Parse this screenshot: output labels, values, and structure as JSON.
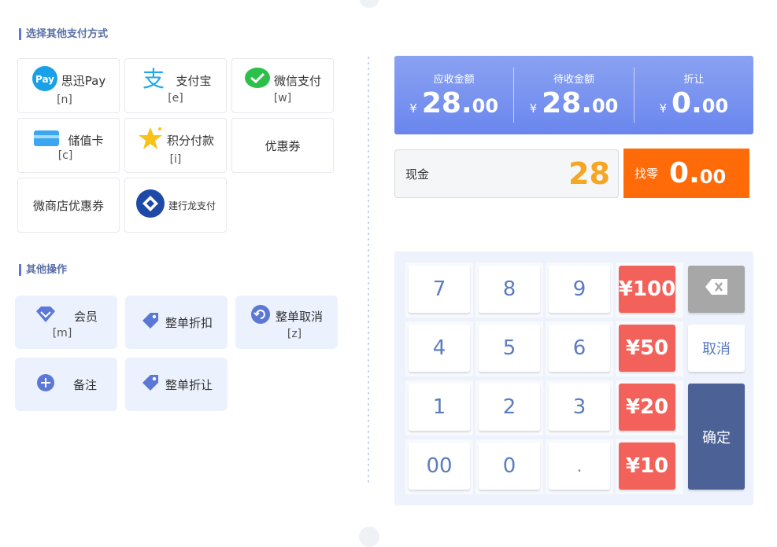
{
  "sections": {
    "payment_title": "选择其他支付方式",
    "ops_title": "其他操作"
  },
  "payments": [
    {
      "label": "思迅Pay",
      "key": "[n]",
      "icon": "pay-icon"
    },
    {
      "label": "支付宝",
      "key": "[e]",
      "icon": "alipay-icon"
    },
    {
      "label": "微信支付",
      "key": "[w]",
      "icon": "wechat-icon"
    },
    {
      "label": "储值卡",
      "key": "[c]",
      "icon": "card-icon"
    },
    {
      "label": "积分付款",
      "key": "[i]",
      "icon": "star-icon"
    },
    {
      "label": "优惠券",
      "key": "",
      "icon": ""
    },
    {
      "label": "微商店优惠券",
      "key": "",
      "icon": ""
    },
    {
      "label": "建行龙支付",
      "key": "",
      "icon": "ccb-icon"
    }
  ],
  "operations": [
    {
      "label": "会员",
      "key": "[m]",
      "icon": "diamond-icon"
    },
    {
      "label": "整单折扣",
      "key": "",
      "icon": "tag-icon"
    },
    {
      "label": "整单取消",
      "key": "[z]",
      "icon": "undo-icon"
    },
    {
      "label": "备注",
      "key": "",
      "icon": "plus-circle-icon"
    },
    {
      "label": "整单折让",
      "key": "",
      "icon": "tag-icon"
    }
  ],
  "summary": {
    "currency": "¥",
    "receivable": {
      "title": "应收金额",
      "int": "28.",
      "dec": "00"
    },
    "pending": {
      "title": "待收金额",
      "int": "28.",
      "dec": "00"
    },
    "discount": {
      "title": "折让",
      "int": "0.",
      "dec": "00"
    }
  },
  "cash": {
    "label": "现金",
    "amount": "28"
  },
  "change": {
    "label": "找零",
    "int": "0.",
    "dec": "00"
  },
  "keypad": {
    "digits": [
      "7",
      "8",
      "9",
      "4",
      "5",
      "6",
      "1",
      "2",
      "3",
      "00",
      "0",
      "."
    ],
    "quick": [
      "¥100",
      "¥50",
      "¥20",
      "¥10"
    ],
    "cancel": "取消",
    "confirm": "确定"
  },
  "colors": {
    "accent": "#6a86ee",
    "orange": "#ff6b08",
    "red": "#f3625a",
    "confirm": "#4c6196",
    "amount": "#f5a623"
  }
}
